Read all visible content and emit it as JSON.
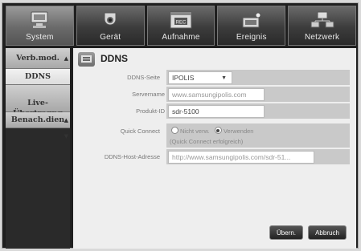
{
  "tabs": [
    {
      "label": "System",
      "icon": "computer-icon"
    },
    {
      "label": "Gerät",
      "icon": "camera-icon"
    },
    {
      "label": "Aufnahme",
      "icon": "rec-icon"
    },
    {
      "label": "Ereignis",
      "icon": "event-icon"
    },
    {
      "label": "Netzwerk",
      "icon": "network-icon"
    }
  ],
  "sidebar": {
    "items": [
      {
        "label": "Verb.mod."
      },
      {
        "label": "DDNS"
      },
      {
        "label": "Live-\nÜbertragng"
      },
      {
        "label": "Benach.dien"
      }
    ]
  },
  "page": {
    "title": "DDNS",
    "icon": "ddns-icon"
  },
  "form": {
    "ddns_site_label": "DDNS-Seite",
    "ddns_site_value": "IPOLIS",
    "server_name_label": "Servername",
    "server_name_value": "www.samsungipolis.com",
    "product_id_label": "Produkt-ID",
    "product_id_value": "sdr-5100",
    "quick_connect_label": "Quick Connect",
    "quick_connect_off": "Nicht verw.",
    "quick_connect_on": "Verwenden",
    "quick_connect_status": "(Quick Connect erfolgreich)",
    "host_address_label": "DDNS-Host-Adresse",
    "host_address_value": "http://www.samsungipolis.com/sdr-51..."
  },
  "buttons": {
    "apply": "Übern.",
    "cancel": "Abbruch"
  },
  "colors": {
    "active_tab": "#7a7a7a",
    "content_bg": "#eeeeee",
    "row_bg": "#c9c9c9"
  }
}
